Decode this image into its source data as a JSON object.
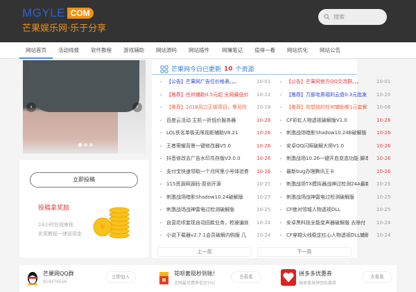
{
  "header": {
    "logo_en": "MGYLE",
    "logo_com": "COM",
    "logo_cn": "芒果娱乐网·乐于分享",
    "search_placeholder": "搜索"
  },
  "nav": [
    {
      "label": "网站首页",
      "active": true
    },
    {
      "label": "活动线报"
    },
    {
      "label": "软件教程"
    },
    {
      "label": "游戏辅助"
    },
    {
      "label": "网站源码"
    },
    {
      "label": "网站插件"
    },
    {
      "label": "网赚笔记"
    },
    {
      "label": "值得一看"
    },
    {
      "label": "网站优化"
    },
    {
      "label": "网站公告"
    }
  ],
  "carousel": {
    "prev": "‹",
    "next": "›",
    "slides": 3,
    "active": 1
  },
  "left_panel": {
    "post_button": "立即投稿",
    "reward_title": "投稿拿奖励",
    "line1": "24小时在线审核",
    "line2": "优质教程一律送现金"
  },
  "updates": {
    "title_prefix": "芒果网今日已更新",
    "count": "10",
    "title_suffix": "个资源",
    "prev_page": "上一页",
    "next_page": "下一页",
    "left": [
      {
        "text": "【公告】芒果网广告位价格表。。。",
        "date": "10-01",
        "color": "blue",
        "new": false
      },
      {
        "text": "【推荐】任何辅助0.5元起 全网最低价",
        "date": "10-22",
        "color": "red",
        "new": false
      },
      {
        "text": "【推荐】2018风口正规项目，零风险",
        "date": "10-18",
        "color": "orange",
        "new": false
      },
      {
        "text": "百度云活动 主机一折低价服务器",
        "date": "10-26",
        "color": "dark",
        "new": true
      },
      {
        "text": "LOL佚名单板无限视距辅助V8.21",
        "date": "10-26",
        "color": "dark",
        "new": true
      },
      {
        "text": "王者荣耀背景一键修改器V5.0",
        "date": "10-26",
        "color": "dark",
        "new": true
      },
      {
        "text": "抖音修改去广告水印共存版V3.0.0",
        "date": "10-26",
        "color": "dark",
        "new": true
      },
      {
        "text": "支付宝快速领取一个月阿里小号体验券",
        "date": "10-26",
        "color": "dark",
        "new": true
      },
      {
        "text": "115资源网源码-原创开源",
        "date": "10-25",
        "color": "dark",
        "new": false
      },
      {
        "text": "刺激战场暗影Shadow10.24破解版",
        "date": "10-25",
        "color": "dark",
        "new": false
      },
      {
        "text": "刺激战场战神雷电过检测破解版",
        "date": "10-25",
        "color": "dark",
        "new": false
      },
      {
        "text": "自营花呗套现自动回款业务，枪被骗就",
        "date": "10-24",
        "color": "dark",
        "new": false
      },
      {
        "text": "小说下载器v2.7.1会员破解内购版 几",
        "date": "10-24",
        "color": "dark",
        "new": false
      }
    ],
    "right": [
      {
        "text": "【公告】芒果网官方QQ交流群。。。",
        "date": "10-01",
        "color": "red",
        "new": false
      },
      {
        "text": "【推荐】万部宅男福利云盘0.3元批发",
        "date": "10-20",
        "color": "blue",
        "new": false
      },
      {
        "text": "【推荐】你想找的任何辅助都1元套餐?",
        "date": "10-06",
        "color": "orange",
        "new": false
      },
      {
        "text": "CF彩虹人物透视破解版V1.0",
        "date": "10-26",
        "color": "dark",
        "new": true
      },
      {
        "text": "刺激战场暗影Shadow10.24B破解版",
        "date": "10-26",
        "color": "dark",
        "new": true
      },
      {
        "text": "安卓QQ闪照破解大师V1.0",
        "date": "10-26",
        "color": "dark",
        "new": true
      },
      {
        "text": "刺激战场10.26一键开启变态功能 脚本",
        "date": "10-26",
        "color": "dark",
        "new": true
      },
      {
        "text": "最新bug办理腾讯王卡",
        "date": "10-26",
        "color": "dark",
        "new": true
      },
      {
        "text": "刺激战场TX模拟器战神过检测24A最新",
        "date": "10-25",
        "color": "dark",
        "new": false
      },
      {
        "text": "刺激战场战神雷电过检测破解版",
        "date": "10-25",
        "color": "dark",
        "new": false
      },
      {
        "text": "CF绝对领域人物透视DLL",
        "date": "10-25",
        "color": "dark",
        "new": false
      },
      {
        "text": "安卓黑科技全能变声器破解版 去除付",
        "date": "10-24",
        "color": "dark",
        "new": false
      },
      {
        "text": "CF穿越火线稳定红心人物透视DLL辅助",
        "date": "10-24",
        "color": "dark",
        "new": false
      }
    ]
  },
  "bottom": [
    {
      "name": "芒果网QQ群",
      "sub": "819476556",
      "button": "立即加入",
      "icon": "qq-penguin-icon"
    },
    {
      "name": "花呗套现秒到账!",
      "sub": "全网最优费率低至5%!",
      "button": "去看看",
      "icon": "red-envelope-icon"
    },
    {
      "name": "拼多多优惠券",
      "sub": "独家首发拼团优惠券",
      "button": "去看看",
      "icon": "pinduoduo-icon"
    }
  ],
  "colors": {
    "header_bg": "#333333",
    "accent": "#f0921a",
    "link_blue": "#2f7de1",
    "new_red": "#e4393c"
  }
}
